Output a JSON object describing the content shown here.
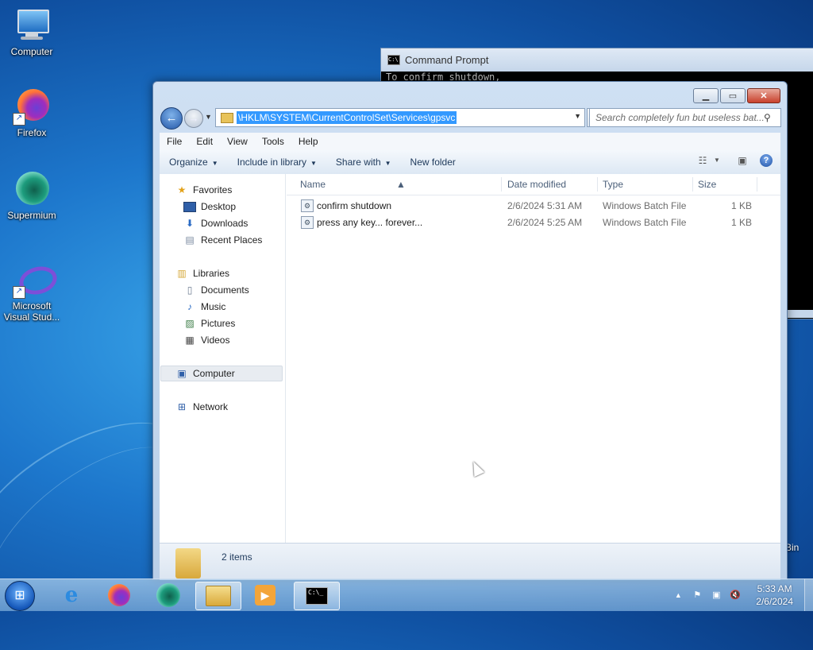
{
  "desktop": {
    "icons": [
      {
        "label": "Computer"
      },
      {
        "label": "Firefox"
      },
      {
        "label": "Supermium"
      },
      {
        "label": "Microsoft Visual Stud..."
      }
    ],
    "recycle_bin_partial": "Bin"
  },
  "cmd_window": {
    "title": "Command Prompt",
    "text": "To confirm shutdown,"
  },
  "explorer": {
    "address": "\\HKLM\\SYSTEM\\CurrentControlSet\\Services\\gpsvc",
    "search_placeholder": "Search completely fun but useless bat...",
    "menu": [
      "File",
      "Edit",
      "View",
      "Tools",
      "Help"
    ],
    "toolbar": {
      "organize": "Organize",
      "include_in_library": "Include in library",
      "share_with": "Share with",
      "new_folder": "New folder"
    },
    "nav": {
      "favorites": "Favorites",
      "desktop": "Desktop",
      "downloads": "Downloads",
      "recent_places": "Recent Places",
      "libraries": "Libraries",
      "documents": "Documents",
      "music": "Music",
      "pictures": "Pictures",
      "videos": "Videos",
      "computer": "Computer",
      "network": "Network"
    },
    "columns": {
      "name": "Name",
      "date_modified": "Date modified",
      "type": "Type",
      "size": "Size"
    },
    "files": [
      {
        "name": "confirm shutdown",
        "date": "2/6/2024 5:31 AM",
        "type": "Windows Batch File",
        "size": "1 KB"
      },
      {
        "name": "press any key... forever...",
        "date": "2/6/2024 5:25 AM",
        "type": "Windows Batch File",
        "size": "1 KB"
      }
    ],
    "status_count": "2 items"
  },
  "taskbar": {
    "time": "5:33 AM",
    "date": "2/6/2024"
  }
}
